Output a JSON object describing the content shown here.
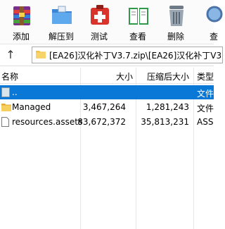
{
  "toolbar": {
    "items": [
      {
        "label": "添加",
        "icon": "add-archive-icon"
      },
      {
        "label": "解压到",
        "icon": "extract-folder-icon"
      },
      {
        "label": "测试",
        "icon": "test-kit-icon"
      },
      {
        "label": "查看",
        "icon": "view-book-icon"
      },
      {
        "label": "删除",
        "icon": "trash-bin-icon"
      },
      {
        "label": "查",
        "icon": "find-icon"
      }
    ]
  },
  "address": {
    "path": "[EA26]汉化补丁V3.7.zip\\[EA26]汉化补丁V3"
  },
  "columns": {
    "name": "名称",
    "size": "大小",
    "packed": "压缩后大小",
    "type": "类型"
  },
  "rows": [
    {
      "name": "..",
      "size": "",
      "packed": "",
      "type": "文件",
      "selected": true
    },
    {
      "name": "Managed",
      "size": "3,467,264",
      "packed": "1,281,243",
      "type": "文件"
    },
    {
      "name": "resources.assets",
      "size": "83,672,372",
      "packed": "35,813,231",
      "type": "ASS"
    }
  ],
  "colors": {
    "selection": "#0a78d7",
    "folder": "#f2c34b"
  }
}
